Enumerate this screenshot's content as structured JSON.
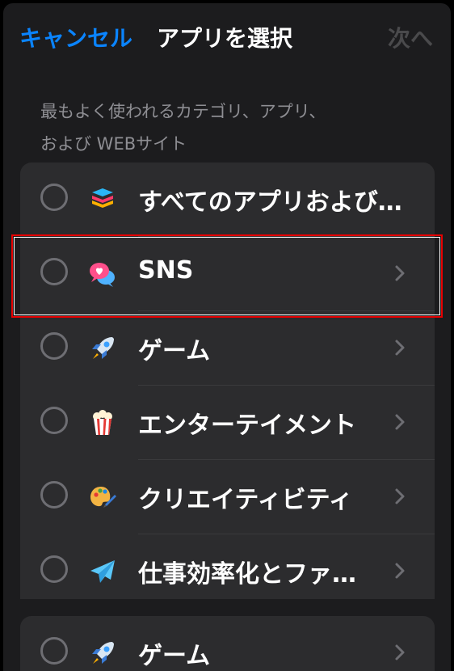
{
  "header": {
    "cancel_label": "キャンセル",
    "title": "アプリを選択",
    "next_label": "次へ"
  },
  "description": "最もよくく使われるカテゴリ、アプリ、および WEB サイト",
  "description_lines": [
    "最もよく使われるカテゴリ、アプリ、",
    "および WEBサイト"
  ],
  "categories": [
    {
      "label": "すべてのアプリおよび…",
      "icon": "stack-icon",
      "has_chevron": false
    },
    {
      "label": "SNS",
      "icon": "chat-heart-icon",
      "has_chevron": true
    },
    {
      "label": "ゲーム",
      "icon": "rocket-icon",
      "has_chevron": true
    },
    {
      "label": "エンターテイメント",
      "icon": "popcorn-icon",
      "has_chevron": true
    },
    {
      "label": "クリエイティビティ",
      "icon": "palette-icon",
      "has_chevron": true
    },
    {
      "label": "仕事効率化とファ…",
      "icon": "paper-plane-icon",
      "has_chevron": true
    }
  ],
  "second_group": [
    {
      "label": "ゲーム",
      "icon": "rocket-icon",
      "has_chevron": true
    }
  ],
  "colors": {
    "accent": "#0a84ff",
    "background": "#1c1c1e",
    "row_background": "#2c2c2e",
    "highlight": "#e60000"
  }
}
